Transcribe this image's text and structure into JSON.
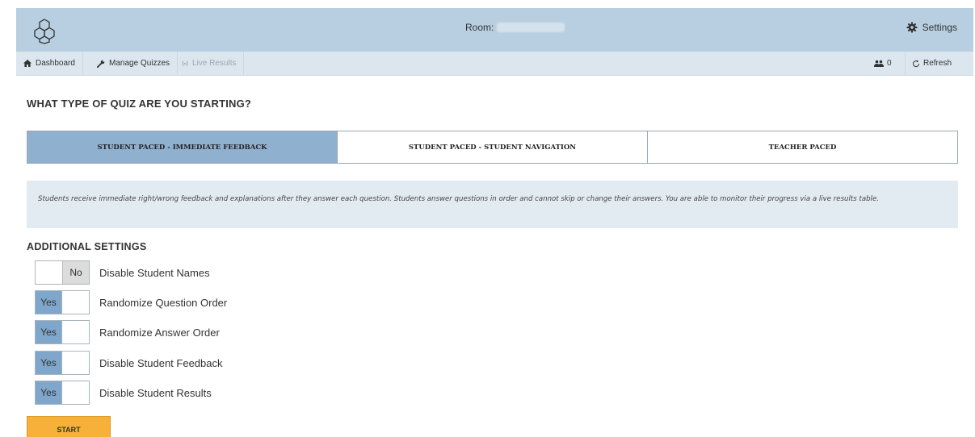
{
  "header": {
    "room_label": "Room:",
    "settings_label": "Settings"
  },
  "nav": {
    "items": [
      {
        "label": "Dashboard",
        "icon": "home-icon"
      },
      {
        "label": "Manage Quizzes",
        "icon": "wrench-icon"
      },
      {
        "label": "Live Results",
        "icon": "broadcast-icon"
      }
    ],
    "student_count": "0",
    "refresh_label": "Refresh"
  },
  "main": {
    "heading": "WHAT TYPE OF QUIZ ARE YOU STARTING?",
    "tabs": [
      {
        "label": "STUDENT PACED - IMMEDIATE FEEDBACK",
        "active": true
      },
      {
        "label": "STUDENT PACED - STUDENT NAVIGATION",
        "active": false
      },
      {
        "label": "TEACHER PACED",
        "active": false
      }
    ],
    "description": "Students receive immediate right/wrong feedback and explanations after they answer each question. Students answer questions in order and cannot skip or change their answers. You are able to monitor their progress via a live results table.",
    "additional_heading": "ADDITIONAL SETTINGS",
    "settings": [
      {
        "label": "Disable Student Names",
        "value": "No"
      },
      {
        "label": "Randomize Question Order",
        "value": "Yes"
      },
      {
        "label": "Randomize Answer Order",
        "value": "Yes"
      },
      {
        "label": "Disable Student Feedback",
        "value": "Yes"
      },
      {
        "label": "Disable Student Results",
        "value": "Yes"
      }
    ],
    "start_label": "START"
  },
  "colors": {
    "topbar": "#b7cfe1",
    "navbar": "#dbe6ef",
    "active_tab": "#8fb0ce",
    "toggle_on": "#7fa6cb",
    "start_button": "#f7b03a"
  }
}
